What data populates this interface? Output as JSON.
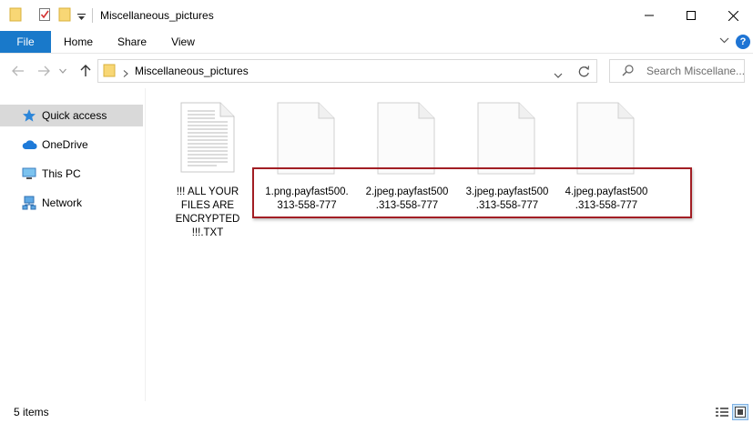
{
  "window": {
    "title": "Miscellaneous_pictures"
  },
  "ribbon": {
    "tabs": [
      "File",
      "Home",
      "Share",
      "View"
    ],
    "help_label": "?"
  },
  "address": {
    "path": "Miscellaneous_pictures",
    "search_placeholder": "Search Miscellane..."
  },
  "navpane": {
    "items": [
      {
        "label": "Quick access",
        "icon": "star-icon",
        "selected": true
      },
      {
        "label": "OneDrive",
        "icon": "cloud-icon"
      },
      {
        "label": "This PC",
        "icon": "computer-icon"
      },
      {
        "label": "Network",
        "icon": "network-icon"
      }
    ]
  },
  "files": [
    {
      "name": "!!! ALL YOUR FILES ARE ENCRYPTED !!!.TXT",
      "lines": [
        "!!! ALL YOUR",
        "FILES ARE",
        "ENCRYPTED",
        "!!!.TXT"
      ],
      "type": "text"
    },
    {
      "name": "1.png.payfast500.313-558-777",
      "lines": [
        "1.png.payfast500.",
        "313-558-777"
      ],
      "type": "blank"
    },
    {
      "name": "2.jpeg.payfast500.313-558-777",
      "lines": [
        "2.jpeg.payfast500",
        ".313-558-777"
      ],
      "type": "blank"
    },
    {
      "name": "3.jpeg.payfast500.313-558-777",
      "lines": [
        "3.jpeg.payfast500",
        ".313-558-777"
      ],
      "type": "blank"
    },
    {
      "name": "4.jpeg.payfast500.313-558-777",
      "lines": [
        "4.jpeg.payfast500",
        ".313-558-777"
      ],
      "type": "blank"
    }
  ],
  "status": {
    "item_count": "5 items"
  },
  "colors": {
    "file_tab": "#1979ca",
    "highlight": "#a21e24",
    "selected": "#d9d9d9"
  }
}
